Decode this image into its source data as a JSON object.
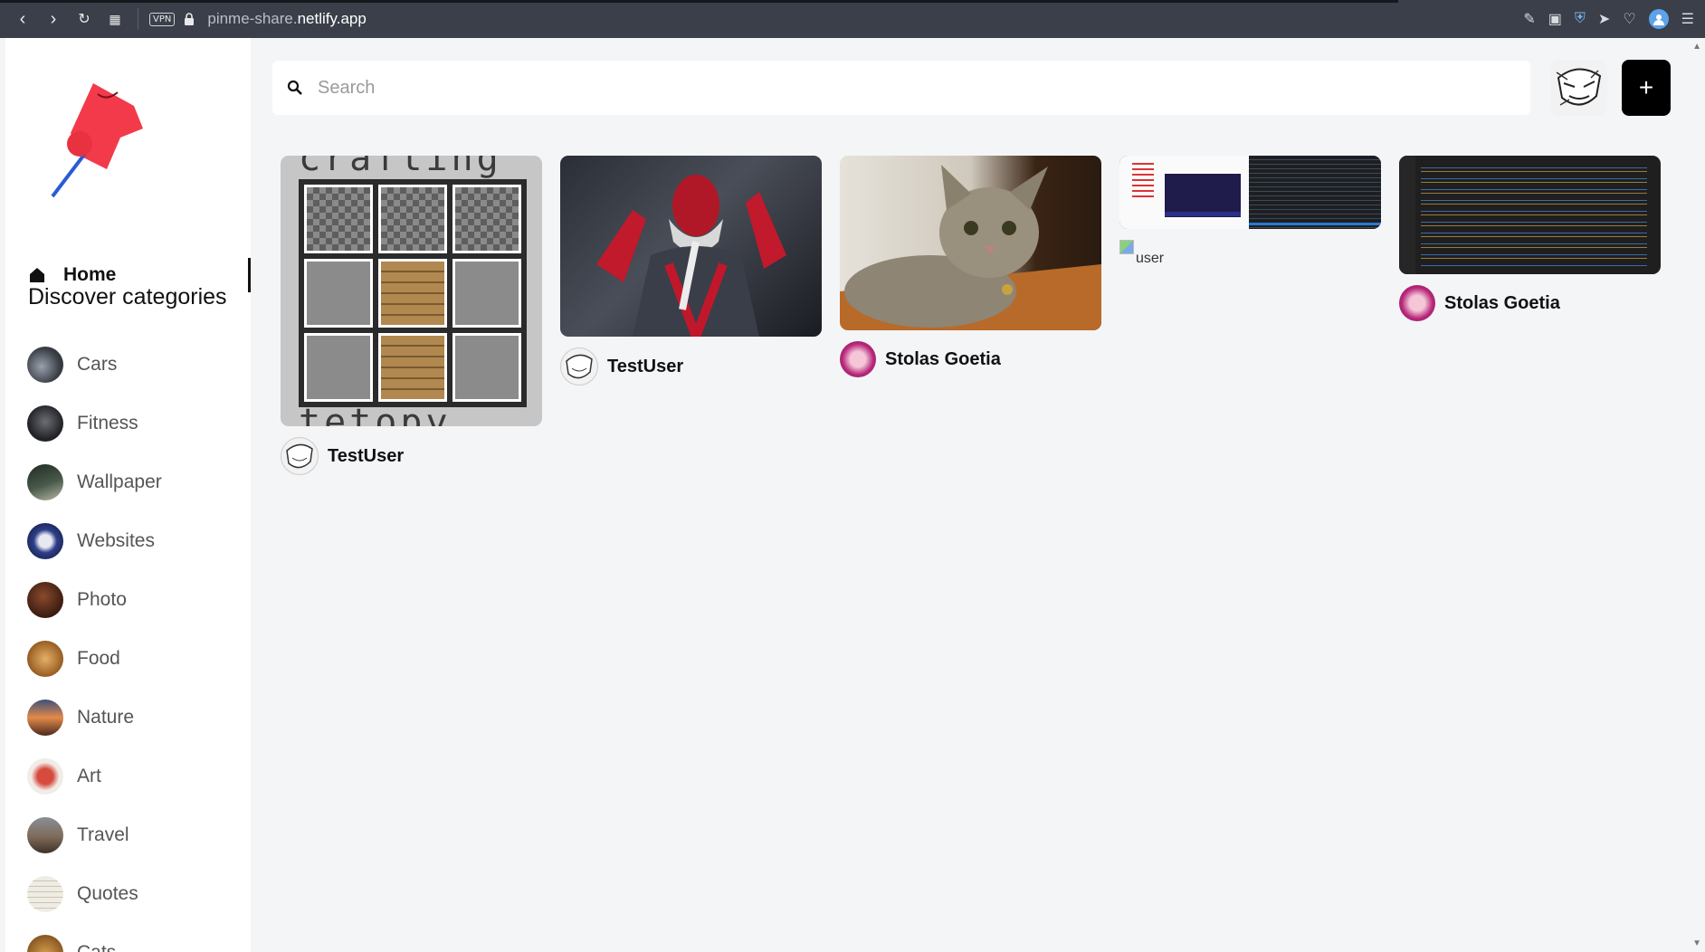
{
  "browser": {
    "url_prefix": "pinme-share.",
    "url_domain": "netlify.app",
    "vpn": "VPN"
  },
  "sidebar": {
    "home_label": "Home",
    "discover_title": "Discover categories",
    "categories": [
      {
        "label": "Cars",
        "color": "#4a4f58"
      },
      {
        "label": "Fitness",
        "color": "#2e2f33"
      },
      {
        "label": "Wallpaper",
        "color": "#3b4a3a"
      },
      {
        "label": "Websites",
        "color": "#2d3f8a"
      },
      {
        "label": "Photo",
        "color": "#4a2a1c"
      },
      {
        "label": "Food",
        "color": "#b07a32"
      },
      {
        "label": "Nature",
        "color": "#c0703e"
      },
      {
        "label": "Art",
        "color": "#d64b3e"
      },
      {
        "label": "Travel",
        "color": "#7d6a58"
      },
      {
        "label": "Quotes",
        "color": "#e6e2d6"
      },
      {
        "label": "Cats",
        "color": "#c08a3a"
      }
    ]
  },
  "search": {
    "placeholder": "Search"
  },
  "add_button": "+",
  "pins": [
    {
      "user": "TestUser",
      "image": "minecraft-crafting-grid",
      "text_top": "crafting",
      "text_bottom": "tetopy"
    },
    {
      "user": "TestUser",
      "image": "armored-cyborg-character"
    },
    {
      "user": "Stolas Goetia",
      "image": "tabby-kitten"
    },
    {
      "user": "",
      "image": "code-editor-screenshot",
      "broken_alt": "user"
    },
    {
      "user": "Stolas Goetia",
      "image": "dark-code-editor"
    }
  ]
}
